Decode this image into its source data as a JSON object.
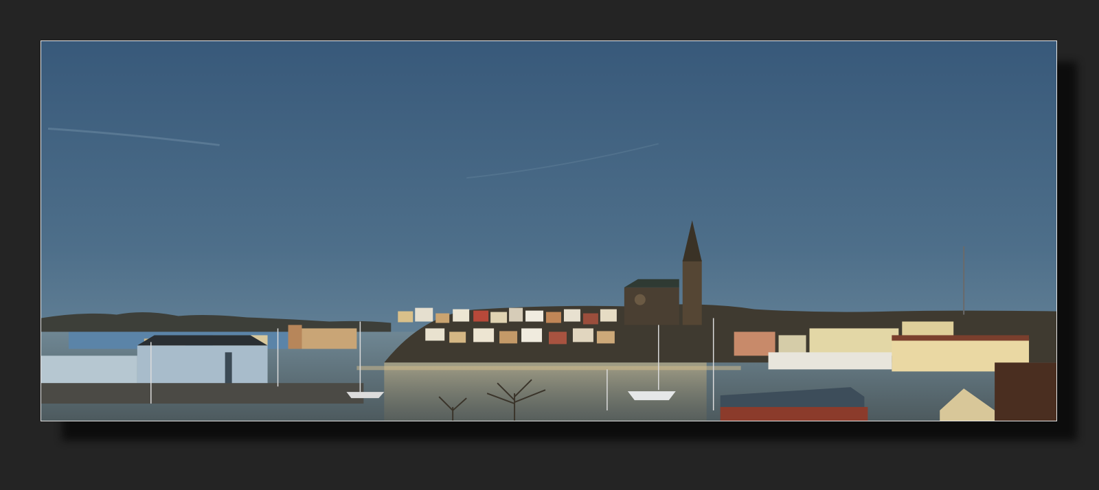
{
  "photo": {
    "subject": "harbour-town-panorama",
    "colors": {
      "background": "#242424",
      "frame_border": "#e6e6e6",
      "sky_top": "#3a5c78",
      "sky_bottom": "#6f8ea3",
      "water": "#8a9aa0",
      "hills": "#3b3d38"
    }
  }
}
